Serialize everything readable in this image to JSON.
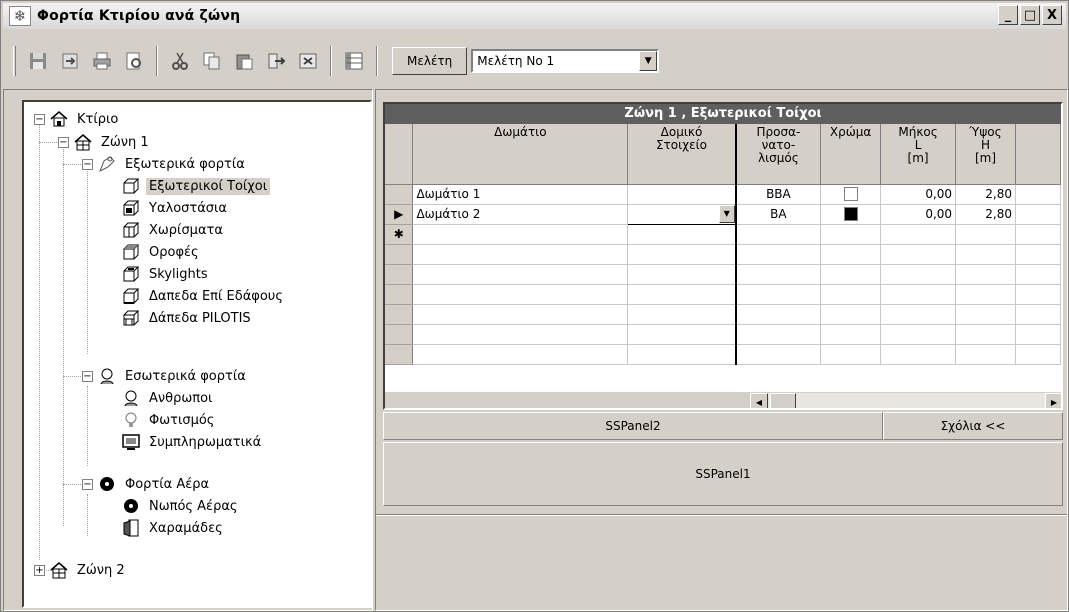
{
  "window": {
    "title": "Φορτία Κτιρίου ανά ζώνη",
    "min_label": "_",
    "max_label": "□",
    "close_label": "X"
  },
  "toolbar": {
    "study_button": "Μελέτη",
    "study_select_value": "Μελέτη No 1",
    "icons": [
      "save-icon",
      "import-icon",
      "print-icon",
      "preview-icon",
      "cut-icon",
      "copy-icon",
      "paste-icon",
      "export-icon",
      "delete-icon",
      "grid-icon"
    ]
  },
  "tree": {
    "building": "Κτίριο",
    "zone1": "Ζώνη 1",
    "external_loads": "Εξωτερικά φορτία",
    "external_walls": "Εξωτερικοί Τοίχοι",
    "glazing": "Υαλοστάσια",
    "partitions": "Χωρίσματα",
    "roofs": "Οροφές",
    "skylights": "Skylights",
    "ground_floors": "Δαπεδα Επί Εδάφους",
    "pilotis_floors": "Δάπεδα PILOTIS",
    "internal_loads": "Εσωτερικά φορτία",
    "people": "Ανθρωποι",
    "lighting": "Φωτισμός",
    "equipment": "Συμπληρωματικά",
    "air_loads": "Φορτία Αέρα",
    "fresh_air": "Νωπός Αέρας",
    "cracks": "Χαραμάδες",
    "zone2": "Ζώνη 2"
  },
  "grid": {
    "caption": "Ζώνη 1  , Εξωτερικοί Τοίχοι",
    "headers": {
      "room": "Δωμάτιο",
      "element_1": "Δομικό",
      "element_2": "Στοιχείο",
      "orient_1": "Προσα-",
      "orient_2": "νατο-",
      "orient_3": "λισμός",
      "color": "Χρώμα",
      "length_1": "Μήκος",
      "length_2": "L",
      "length_3": "[m]",
      "height_1": "Ύψος",
      "height_2": "H",
      "height_3": "[m]"
    },
    "rows": [
      {
        "room": "Δωμάτιο 1",
        "element": "",
        "orientation": "ΒΒΑ",
        "color": "#ffffff",
        "length": "0,00",
        "height": "2,80"
      },
      {
        "room": "Δωμάτιο 2",
        "element": "",
        "orientation": "ΒΑ",
        "color": "#000000",
        "length": "0,00",
        "height": "2,80"
      }
    ],
    "current_row_marker": "▶",
    "new_row_marker": "✱"
  },
  "panels": {
    "panel2": "SSPanel2",
    "notes_button": "Σχόλια <<",
    "panel1": "SSPanel1"
  }
}
